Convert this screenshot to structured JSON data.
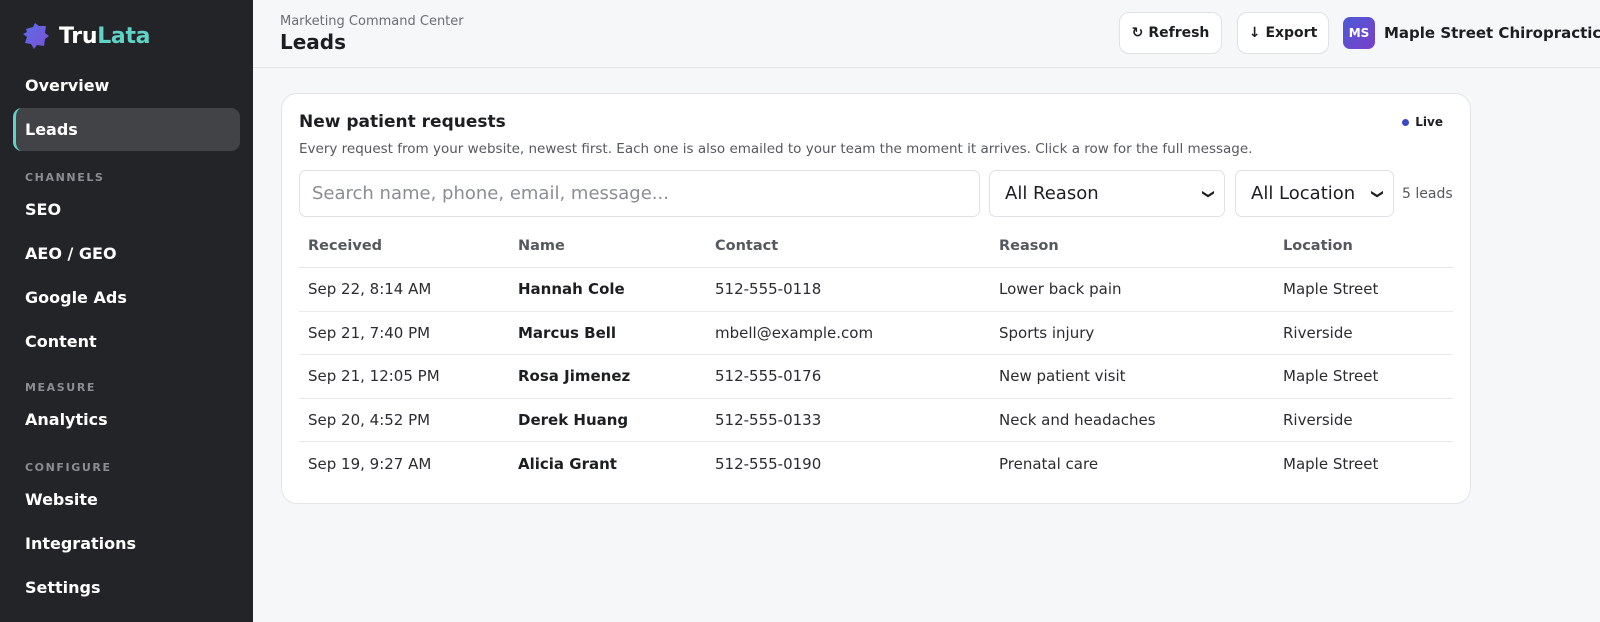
{
  "brand": {
    "name_a": "Tru",
    "name_b": "Lata",
    "logo": "puzzle-logo"
  },
  "sidebar": {
    "items": [
      {
        "label": "Overview"
      },
      {
        "label": "Leads",
        "active": true
      },
      {
        "label": "SEO"
      },
      {
        "label": "AEO / GEO"
      },
      {
        "label": "Google Ads"
      },
      {
        "label": "Content"
      },
      {
        "label": "Analytics"
      },
      {
        "label": "Website"
      },
      {
        "label": "Integrations"
      },
      {
        "label": "Settings"
      }
    ],
    "sections": {
      "channels": "CHANNELS",
      "measure": "MEASURE",
      "configure": "CONFIGURE"
    }
  },
  "header": {
    "breadcrumb": "Marketing Command Center",
    "title": "Leads",
    "refresh_label": "Refresh",
    "refresh_icon": "refresh-icon",
    "export_label": "Export",
    "export_icon": "download-arrow-icon",
    "org_initials": "MS",
    "org_name": "Maple Street Chiropractic"
  },
  "card": {
    "title": "New patient requests",
    "subtitle": "Every request from your website, newest first. Each one is also emailed to your team the moment it arrives. Click a row for the full message.",
    "live_label": "Live",
    "search_placeholder": "Search name, phone, email, message...",
    "reason_filter": "All Reason",
    "location_filter": "All Location",
    "count_label": "5 leads"
  },
  "table": {
    "headers": [
      "Received",
      "Name",
      "Contact",
      "Reason",
      "Location"
    ],
    "rows": [
      [
        "Sep 22, 8:14 AM",
        "Hannah Cole",
        "512-555-0118",
        "Lower back pain",
        "Maple Street"
      ],
      [
        "Sep 21, 7:40 PM",
        "Marcus Bell",
        "mbell@example.com",
        "Sports injury",
        "Riverside"
      ],
      [
        "Sep 21, 12:05 PM",
        "Rosa Jimenez",
        "512-555-0176",
        "New patient visit",
        "Maple Street"
      ],
      [
        "Sep 20, 4:52 PM",
        "Derek Huang",
        "512-555-0133",
        "Neck and headaches",
        "Riverside"
      ],
      [
        "Sep 19, 9:27 AM",
        "Alicia Grant",
        "512-555-0190",
        "Prenatal care",
        "Maple Street"
      ]
    ]
  },
  "colors": {
    "accent": "#5fd3c6",
    "sidebar_bg": "#232427",
    "live_dot": "#3b49c4"
  }
}
